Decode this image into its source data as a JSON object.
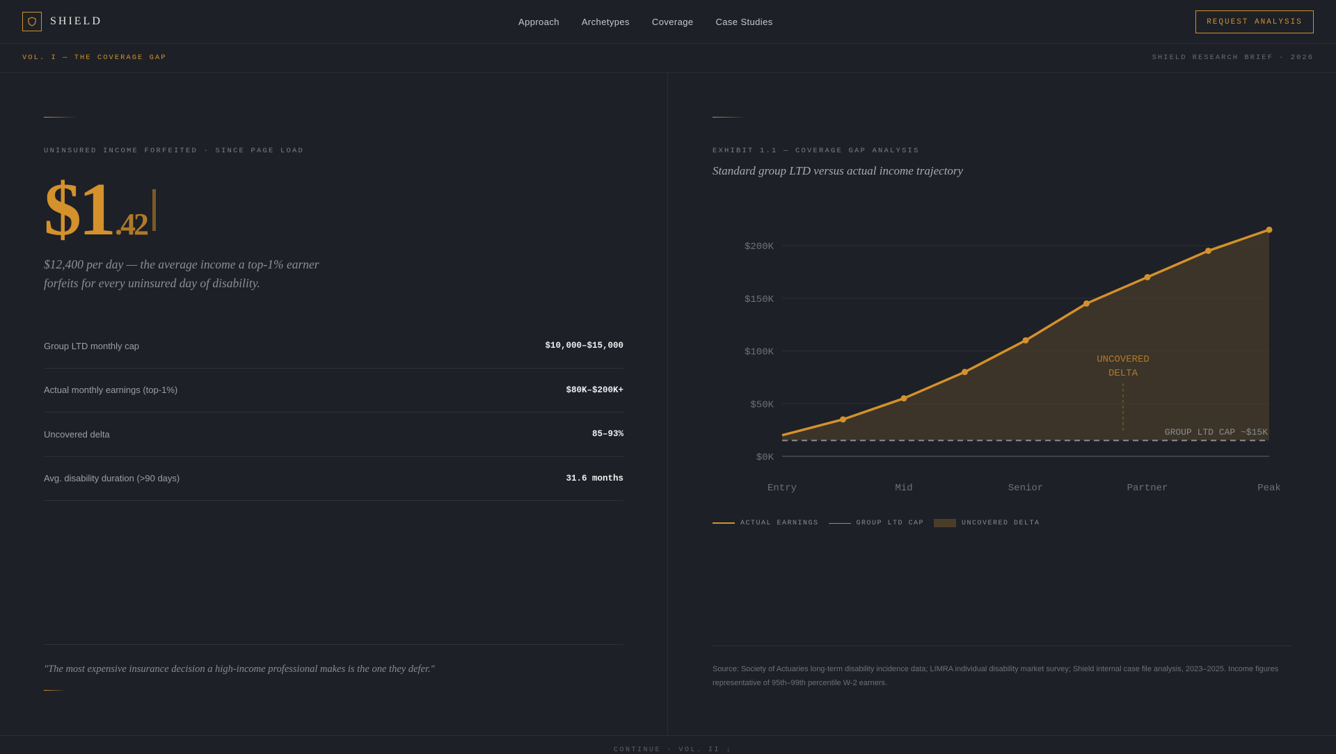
{
  "header": {
    "brand": "SHIELD",
    "nav": [
      "Approach",
      "Archetypes",
      "Coverage",
      "Case Studies"
    ],
    "cta_label": "REQUEST ANALYSIS"
  },
  "subbar": {
    "volume": "VOL. I — THE COVERAGE GAP",
    "brief": "SHIELD RESEARCH BRIEF · 2026"
  },
  "left": {
    "counter_label": "UNINSURED INCOME FORFEITED · SINCE PAGE LOAD",
    "counter_dollars": "$1",
    "counter_cents": ".42",
    "lede": "$12,400 per day — the average income a top-1% earner forfeits for every uninsured day of disability.",
    "stats": [
      {
        "label": "Group LTD monthly cap",
        "value": "$10,000–$15,000"
      },
      {
        "label": "Actual monthly earnings (top-1%)",
        "value": "$80K–$200K+"
      },
      {
        "label": "Uncovered delta",
        "value": "85–93%"
      },
      {
        "label": "Avg. disability duration (>90 days)",
        "value": "31.6 months"
      }
    ],
    "quote": "\"The most expensive insurance decision a high-income professional makes is the one they defer.\""
  },
  "right": {
    "exhibit_label": "EXHIBIT 1.1 — COVERAGE GAP ANALYSIS",
    "exhibit_title": "Standard group LTD versus actual income trajectory",
    "legend": {
      "earnings": "ACTUAL EARNINGS",
      "cap": "GROUP LTD CAP",
      "delta": "UNCOVERED DELTA"
    },
    "source": "Source: Society of Actuaries long-term disability incidence data; LIMRA individual disability market survey; Shield internal case file analysis, 2023–2025. Income figures representative of 95th–99th percentile W-2 earners."
  },
  "footer": {
    "continue": "CONTINUE · VOL. II ↓"
  },
  "colors": {
    "accent": "#d4912c",
    "background": "#1d2027",
    "delta_fill": "#4a3d2a"
  },
  "chart_data": {
    "type": "line",
    "title": "",
    "xlabel": "",
    "ylabel": "",
    "categories": [
      "Entry",
      "Mid",
      "Senior",
      "Partner",
      "Peak"
    ],
    "x": [
      0,
      0.5,
      1,
      1.5,
      2,
      2.5,
      3,
      3.5,
      4
    ],
    "series": [
      {
        "name": "ACTUAL EARNINGS",
        "values": [
          20000,
          35000,
          55000,
          80000,
          110000,
          145000,
          170000,
          195000,
          215000
        ]
      },
      {
        "name": "GROUP LTD CAP",
        "values": [
          15000,
          15000,
          15000,
          15000,
          15000,
          15000,
          15000,
          15000,
          15000
        ]
      }
    ],
    "yticks": [
      "$0K",
      "$50K",
      "$100K",
      "$150K",
      "$200K"
    ],
    "ytick_values": [
      0,
      50000,
      100000,
      150000,
      200000
    ],
    "ylim": [
      0,
      200000
    ],
    "annotations": {
      "delta": [
        "UNCOVERED",
        "DELTA"
      ],
      "cap": "GROUP LTD CAP ~$15K"
    },
    "grid": true,
    "legend_position": "bottom-left"
  }
}
